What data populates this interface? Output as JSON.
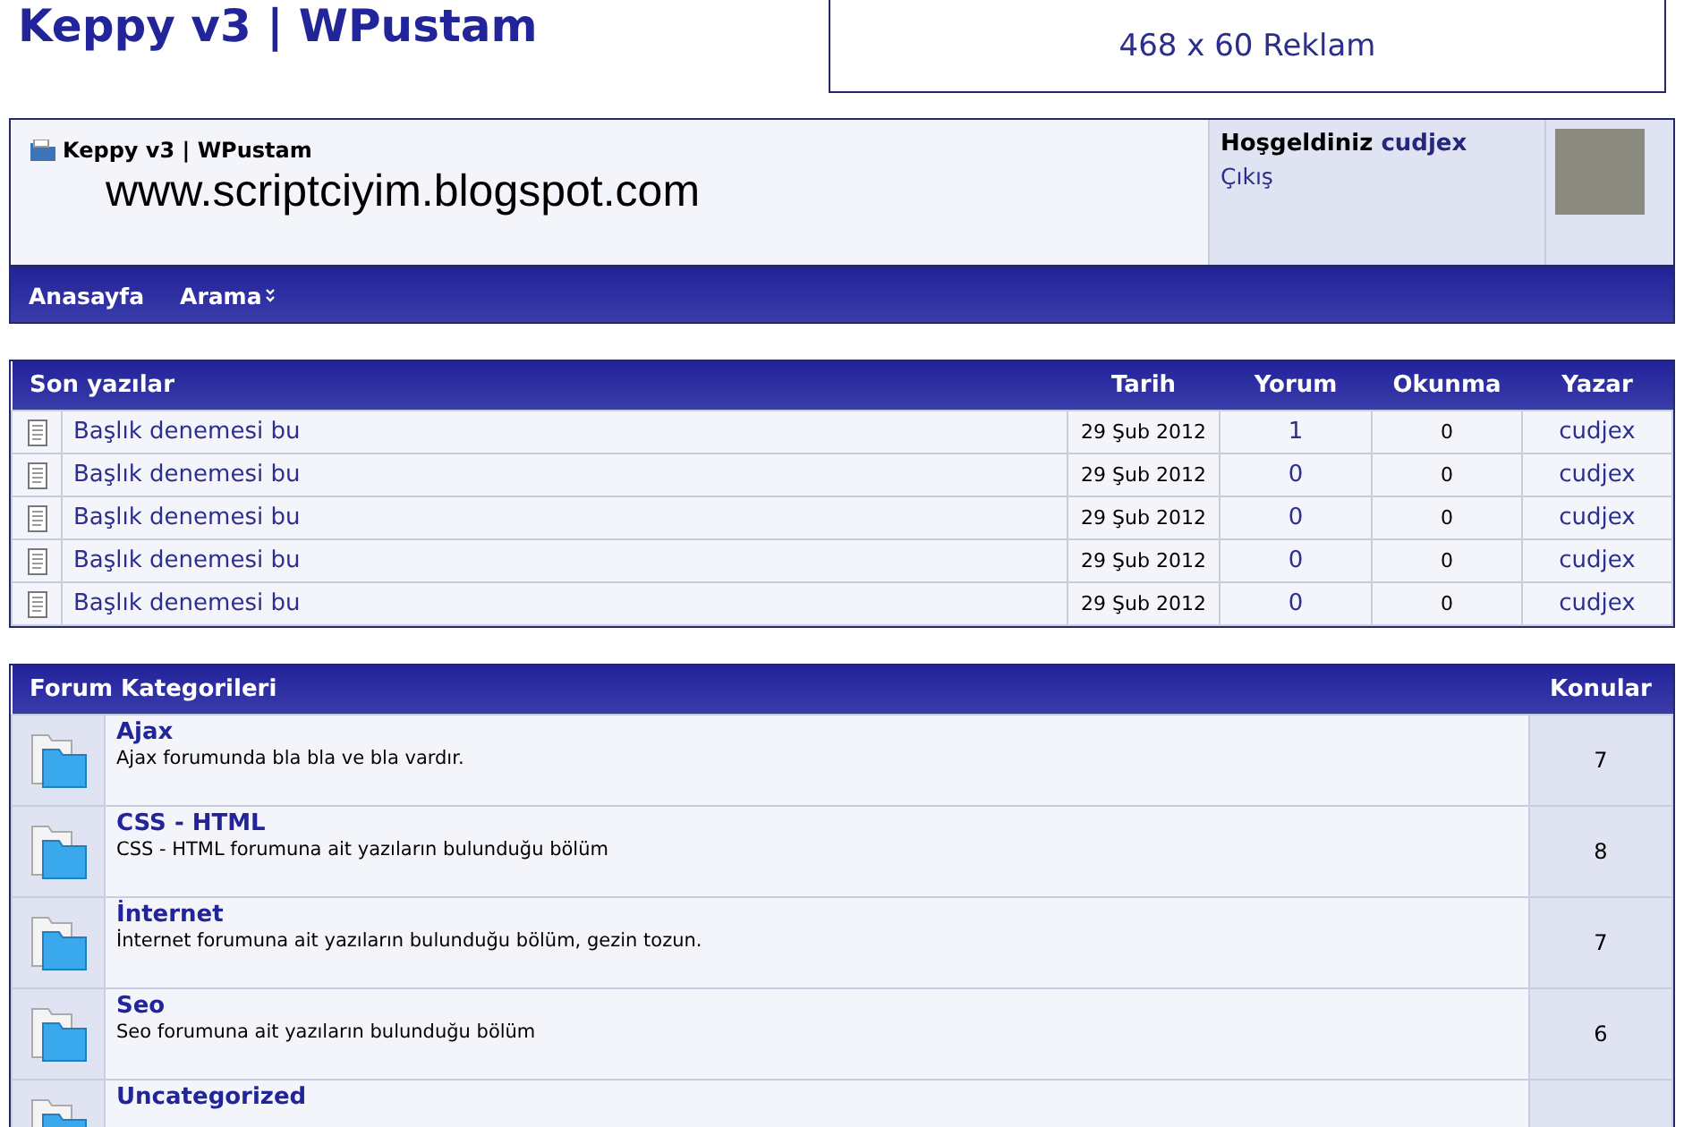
{
  "site_title": "Keppy v3 | WPustam",
  "ad_banner": "468 x 60 Reklam",
  "header": {
    "breadcrumb": "Keppy v3 | WPustam",
    "tagline": "www.scriptciyim.blogspot.com",
    "welcome": "Hoşgeldiniz",
    "username": "cudjex",
    "logout": "Çıkış"
  },
  "nav": [
    {
      "label": "Anasayfa",
      "dropdown": false
    },
    {
      "label": "Arama",
      "dropdown": true
    }
  ],
  "recent_posts": {
    "title": "Son yazılar",
    "columns": [
      "Tarih",
      "Yorum",
      "Okunma",
      "Yazar"
    ],
    "rows": [
      {
        "title": "Başlık denemesi bu",
        "date": "29 Şub 2012",
        "comments": "1",
        "views": "0",
        "author": "cudjex"
      },
      {
        "title": "Başlık denemesi bu",
        "date": "29 Şub 2012",
        "comments": "0",
        "views": "0",
        "author": "cudjex"
      },
      {
        "title": "Başlık denemesi bu",
        "date": "29 Şub 2012",
        "comments": "0",
        "views": "0",
        "author": "cudjex"
      },
      {
        "title": "Başlık denemesi bu",
        "date": "29 Şub 2012",
        "comments": "0",
        "views": "0",
        "author": "cudjex"
      },
      {
        "title": "Başlık denemesi bu",
        "date": "29 Şub 2012",
        "comments": "0",
        "views": "0",
        "author": "cudjex"
      }
    ]
  },
  "forum_categories": {
    "title": "Forum Kategorileri",
    "count_column": "Konular",
    "rows": [
      {
        "name": "Ajax",
        "description": "Ajax forumunda bla bla ve bla vardır.",
        "topics": "7"
      },
      {
        "name": "CSS - HTML",
        "description": "CSS - HTML forumuna ait yazıların bulunduğu bölüm",
        "topics": "8"
      },
      {
        "name": "İnternet",
        "description": "İnternet forumuna ait yazıların bulunduğu bölüm, gezin tozun.",
        "topics": "7"
      },
      {
        "name": "Seo",
        "description": "Seo forumuna ait yazıların bulunduğu bölüm",
        "topics": "6"
      },
      {
        "name": "Uncategorized"
      }
    ]
  }
}
